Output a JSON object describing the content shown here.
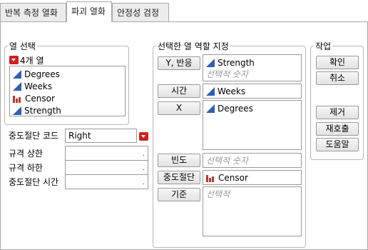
{
  "tabs": [
    {
      "label": "반복 측정 열화"
    },
    {
      "label": "파괴 열화"
    },
    {
      "label": "안정성 검정"
    }
  ],
  "columns": {
    "group_title": "열 선택",
    "count_label": "4개 열",
    "items": [
      {
        "label": "Degrees",
        "icon": "continuous-icon"
      },
      {
        "label": "Weeks",
        "icon": "continuous-icon"
      },
      {
        "label": "Censor",
        "icon": "nominal-icon"
      },
      {
        "label": "Strength",
        "icon": "continuous-icon"
      }
    ]
  },
  "fields": {
    "censor_code_label": "중도절단 코드",
    "censor_code_value": "Right",
    "upper_spec_label": "규격 상한",
    "lower_spec_label": "규격 하한",
    "censor_time_label": "중도절단 시간",
    "field_dot": "."
  },
  "roles": {
    "group_title": "선택한 열 역할 지정",
    "y_button": "Y, 반응",
    "y_value": "Strength",
    "y_placeholder": "선택적 숫자",
    "time_button": "시간",
    "time_value": "Weeks",
    "x_button": "X",
    "x_value": "Degrees",
    "freq_button": "빈도",
    "freq_placeholder": "선택적 숫자",
    "censor_button": "중도절단",
    "censor_value": "Censor",
    "by_button": "기준",
    "by_placeholder": "선택적"
  },
  "actions": {
    "group_title": "작업",
    "ok": "확인",
    "cancel": "취소",
    "remove": "제거",
    "recall": "재호출",
    "help": "도움말"
  },
  "colors": {
    "continuous_icon": "#2f5fb3",
    "nominal_icon": "#c0392b",
    "dropdown_red": "#d21f1f"
  }
}
